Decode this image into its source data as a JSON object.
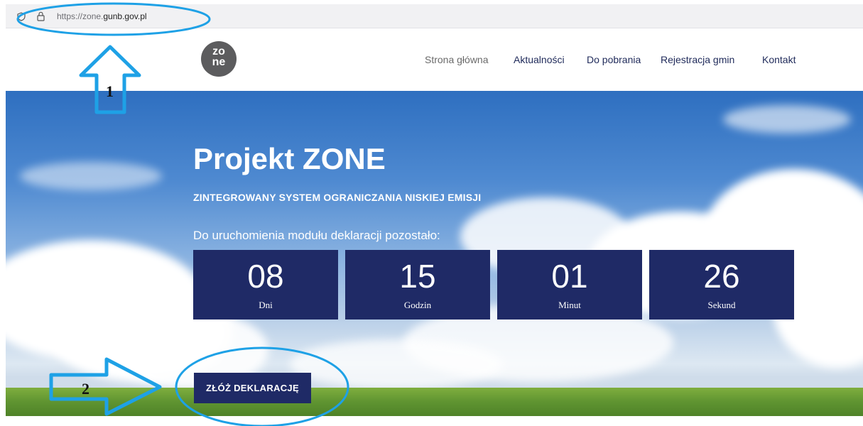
{
  "browser": {
    "url_prefix": "https://zone.",
    "url_domain": "gunb.gov.pl"
  },
  "logo": {
    "line1": "zo",
    "line2": "ne"
  },
  "nav": {
    "items": [
      {
        "label": "Strona główna",
        "active": true
      },
      {
        "label": "Aktualności",
        "active": false
      },
      {
        "label": "Do pobrania",
        "active": false
      },
      {
        "label": "Rejestracja gmin",
        "active": false
      },
      {
        "label": "Kontakt",
        "active": false
      }
    ]
  },
  "hero": {
    "title": "Projekt ZONE",
    "subtitle": "ZINTEGROWANY SYSTEM OGRANICZANIA NISKIEJ EMISJI",
    "countdown_label": "Do uruchomienia modułu deklaracji pozostało:",
    "countdown": [
      {
        "value": "08",
        "unit": "Dni"
      },
      {
        "value": "15",
        "unit": "Godzin"
      },
      {
        "value": "01",
        "unit": "Minut"
      },
      {
        "value": "26",
        "unit": "Sekund"
      }
    ],
    "cta_label": "ZŁÓŻ DEKLARACJĘ"
  },
  "annotations": {
    "marker_1": "1",
    "marker_2": "2"
  },
  "colors": {
    "brand_navy": "#1f2a66",
    "annotation_blue": "#1ea1e6"
  }
}
